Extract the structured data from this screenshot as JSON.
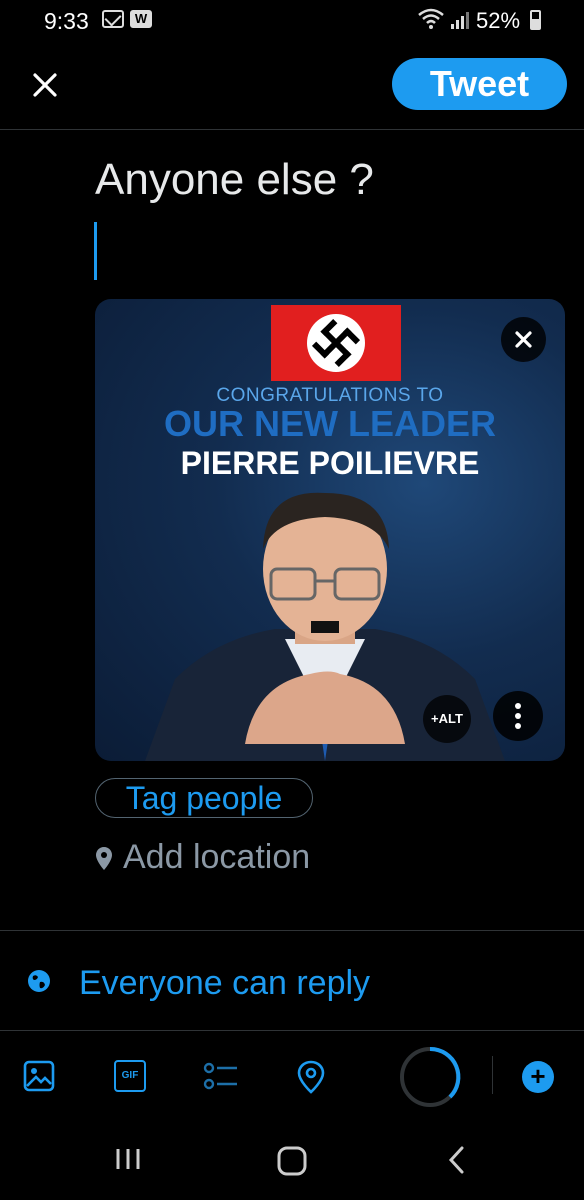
{
  "status_bar": {
    "time": "9:33",
    "notification_icons": [
      "mail-icon",
      "w-app-icon"
    ],
    "w_badge": "W",
    "battery": "52%"
  },
  "header": {
    "close_icon": "close-icon",
    "tweet_label": "Tweet"
  },
  "compose": {
    "text": "Anyone else ?"
  },
  "media": {
    "headline_small": "CONGRATULATIONS TO",
    "headline_large": "OUR NEW LEADER",
    "headline_name": "PIERRE POILIEVRE",
    "alt_label": "+ALT"
  },
  "actions": {
    "tag_people": "Tag people",
    "add_location": "Add location"
  },
  "reply_setting": {
    "label": "Everyone can reply"
  },
  "toolbar": {
    "icons": [
      "image-icon",
      "gif-icon",
      "poll-icon",
      "location-icon"
    ],
    "gif_text": "GIF",
    "add_label": "+"
  },
  "colors": {
    "accent": "#1d9bf0",
    "background": "#000000",
    "divider": "#2f3336",
    "muted": "#8b98a5"
  }
}
